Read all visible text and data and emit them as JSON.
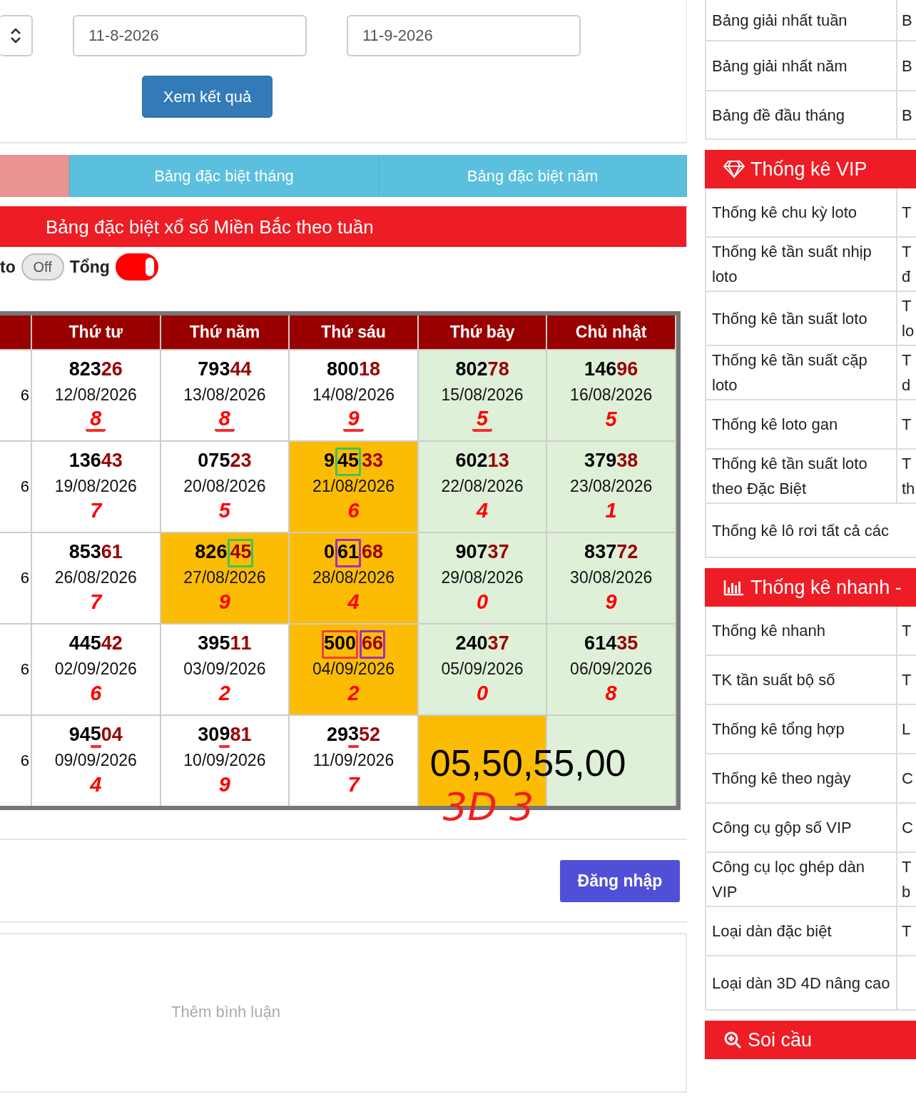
{
  "filter": {
    "from_date": "11-8-2026",
    "to_date": "11-9-2026",
    "submit": "Xem kết quả"
  },
  "tabs": [
    {
      "selected": true
    },
    {
      "label": "Bảng đặc biệt tháng",
      "selected": false
    },
    {
      "label": "Bảng đặc biệt năm",
      "selected": false
    }
  ],
  "section_title": "Bảng đặc biệt xổ số Miền Bắc theo tuần",
  "toggles": [
    {
      "label": "to",
      "state_text": "Off",
      "on": false
    },
    {
      "label": "Tổng",
      "on": true
    }
  ],
  "table": {
    "columns": [
      null,
      "Thứ tư",
      "Thứ năm",
      "Thứ sáu",
      "Thứ bảy",
      "Chủ nhật"
    ],
    "rows": [
      {
        "cells": [
          {
            "kind": "fragment",
            "text": "6"
          },
          {
            "kind": "result",
            "segments": [
              {
                "text": "82326"
              }
            ],
            "date": "12/08/2026",
            "total": "8",
            "color": "#ffffff",
            "total_underlined": true
          },
          {
            "kind": "result",
            "segments": [
              {
                "text": "79344"
              }
            ],
            "date": "13/08/2026",
            "total": "8",
            "color": "#ffffff",
            "total_underlined": true
          },
          {
            "kind": "result",
            "segments": [
              {
                "text": "80018"
              }
            ],
            "date": "14/08/2026",
            "total": "9",
            "color": "#ffffff",
            "total_underlined": true
          },
          {
            "kind": "result",
            "segments": [
              {
                "text": "80278"
              }
            ],
            "date": "15/08/2026",
            "total": "5",
            "color": "#dff0d8",
            "total_underlined": true
          },
          {
            "kind": "result",
            "segments": [
              {
                "text": "14696"
              }
            ],
            "date": "16/08/2026",
            "total": "5",
            "color": "#dff0d8",
            "total_underlined": false
          }
        ]
      },
      {
        "cells": [
          {
            "kind": "fragment",
            "text": "6"
          },
          {
            "kind": "result",
            "segments": [
              {
                "text": "13643"
              }
            ],
            "date": "19/08/2026",
            "total": "7",
            "color": "#ffffff",
            "total_underlined": false
          },
          {
            "kind": "result",
            "segments": [
              {
                "text": "07523"
              }
            ],
            "date": "20/08/2026",
            "total": "5",
            "color": "#ffffff",
            "total_underlined": false
          },
          {
            "kind": "result",
            "segments": [
              {
                "text": "9"
              },
              {
                "text": "45",
                "color": "#3cc35c"
              },
              {
                "text": "33"
              }
            ],
            "date": "21/08/2026",
            "total": "6",
            "color": "#fcbc04",
            "total_underlined": false
          },
          {
            "kind": "result",
            "segments": [
              {
                "text": "60213"
              }
            ],
            "date": "22/08/2026",
            "total": "4",
            "color": "#dff0d8",
            "total_underlined": false
          },
          {
            "kind": "result",
            "segments": [
              {
                "text": "37938"
              }
            ],
            "date": "23/08/2026",
            "total": "1",
            "color": "#dff0d8",
            "total_underlined": false
          }
        ]
      },
      {
        "cells": [
          {
            "kind": "fragment",
            "text": "6"
          },
          {
            "kind": "result",
            "segments": [
              {
                "text": "85361"
              }
            ],
            "date": "26/08/2026",
            "total": "7",
            "color": "#ffffff",
            "total_underlined": false
          },
          {
            "kind": "result",
            "segments": [
              {
                "text": "826"
              },
              {
                "text": "45",
                "color": "#3cc35c"
              }
            ],
            "date": "27/08/2026",
            "total": "9",
            "color": "#fcbc04",
            "total_underlined": false
          },
          {
            "kind": "result",
            "segments": [
              {
                "text": "0"
              },
              {
                "text": "61",
                "color": "#9b30c0"
              },
              {
                "text": "68"
              }
            ],
            "date": "28/08/2026",
            "total": "4",
            "color": "#fcbc04",
            "total_underlined": false
          },
          {
            "kind": "result",
            "segments": [
              {
                "text": "90737"
              }
            ],
            "date": "29/08/2026",
            "total": "0",
            "color": "#dff0d8",
            "total_underlined": false
          },
          {
            "kind": "result",
            "segments": [
              {
                "text": "83772"
              }
            ],
            "date": "30/08/2026",
            "total": "9",
            "color": "#dff0d8",
            "total_underlined": false
          }
        ]
      },
      {
        "cells": [
          {
            "kind": "fragment",
            "text": "6"
          },
          {
            "kind": "result",
            "segments": [
              {
                "text": "44542"
              }
            ],
            "date": "02/09/2026",
            "total": "6",
            "color": "#ffffff",
            "total_underlined": false
          },
          {
            "kind": "result",
            "segments": [
              {
                "text": "39511"
              }
            ],
            "date": "03/09/2026",
            "total": "2",
            "color": "#ffffff",
            "total_underlined": false
          },
          {
            "kind": "result",
            "segments": [
              {
                "text": "500",
                "color": "#f04040"
              },
              {
                "text": "66",
                "color": "#9b30c0"
              }
            ],
            "date": "04/09/2026",
            "total": "2",
            "color": "#fcbc04",
            "total_underlined": false
          },
          {
            "kind": "result",
            "segments": [
              {
                "text": "24037"
              }
            ],
            "date": "05/09/2026",
            "total": "0",
            "color": "#dff0d8",
            "total_underlined": false
          },
          {
            "kind": "result",
            "segments": [
              {
                "text": "61435"
              }
            ],
            "date": "06/09/2026",
            "total": "8",
            "color": "#dff0d8",
            "total_underlined": false
          }
        ]
      },
      {
        "cells": [
          {
            "kind": "fragment",
            "text": "6"
          },
          {
            "kind": "result",
            "segments": [
              {
                "text": "94"
              },
              {
                "text": "5",
                "underlined": true
              },
              {
                "text": "04"
              }
            ],
            "date": "09/09/2026",
            "total": "4",
            "color": "#ffffff",
            "total_underlined": false
          },
          {
            "kind": "result",
            "segments": [
              {
                "text": "30"
              },
              {
                "text": "9",
                "underlined": true
              },
              {
                "text": "81"
              }
            ],
            "date": "10/09/2026",
            "total": "9",
            "color": "#ffffff",
            "total_underlined": false
          },
          {
            "kind": "result",
            "segments": [
              {
                "text": "29"
              },
              {
                "text": "3",
                "underlined": true
              },
              {
                "text": "52"
              }
            ],
            "date": "11/09/2026",
            "total": "7",
            "color": "#ffffff",
            "total_underlined": false
          },
          {
            "kind": "note",
            "text": "05,50,55,00",
            "handwriting": "3D 3",
            "color": "#fcbc04"
          },
          {
            "kind": "empty",
            "color": "#dff0d8"
          }
        ]
      }
    ]
  },
  "comments": {
    "login": "Đăng nhập",
    "placeholder": "Thêm bình luận"
  },
  "sidebar": [
    {
      "kind": "plain",
      "rows": [
        {
          "label": "Bảng giải nhất tuần",
          "column_2": "B"
        },
        {
          "label": "Bảng giải nhất năm",
          "column_2": "B"
        },
        {
          "label": "Bảng đề đầu tháng",
          "column_2": "B"
        }
      ]
    },
    {
      "kind": "vip",
      "title": "Thống kê VIP",
      "rows": [
        {
          "label": "Thống kê chu kỳ loto",
          "column_2": "T"
        },
        {
          "label": "Thống kê tần suất nhịp loto",
          "column_2": "T đ"
        },
        {
          "label": "Thống kê tần suất loto",
          "column_2": "T lo"
        },
        {
          "label": "Thống kê tần suất cặp loto",
          "column_2": "T d"
        },
        {
          "label": "Thống kê loto gan",
          "column_2": "T"
        },
        {
          "label": "Thống kê tần suất loto theo Đặc Biệt",
          "column_2": "T th"
        },
        {
          "label": "Thống kê lô rơi tất cả các"
        }
      ]
    },
    {
      "kind": "chart",
      "title": "Thống kê nhanh -",
      "rows": [
        {
          "label": "Thống kê nhanh",
          "column_2": "T"
        },
        {
          "label": "TK tần suất bộ số",
          "column_2": "T"
        },
        {
          "label": "Thống kê tổng hợp",
          "column_2": "L"
        },
        {
          "label": "Thống kê theo ngày",
          "column_2": "C"
        },
        {
          "label": "Công cụ gộp số VIP",
          "column_2": "C"
        },
        {
          "label": "Công cụ lọc ghép dàn VIP",
          "column_2": "T b"
        },
        {
          "label": "Loại dàn đặc biệt",
          "column_2": "T"
        },
        {
          "label": "Loại dàn 3D 4D nâng cao"
        }
      ]
    },
    {
      "kind": "search",
      "title": "Soi cầu"
    }
  ]
}
